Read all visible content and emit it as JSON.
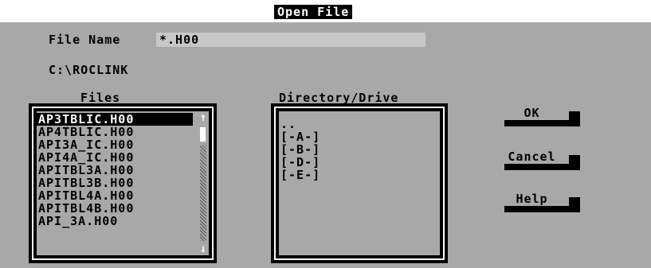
{
  "window": {
    "title": "Open File"
  },
  "file_name": {
    "label": "File Name",
    "value": "*.H00"
  },
  "current_path": "C:\\ROCLINK",
  "files": {
    "label": "Files",
    "items": [
      "AP3TBLIC.H00",
      "AP4TBLIC.H00",
      "API3A_IC.H00",
      "API4A_IC.H00",
      "APITBL3A.H00",
      "APITBL3B.H00",
      "APITBL4A.H00",
      "APITBL4B.H00",
      "API_3A.H00"
    ],
    "selected_index": 0
  },
  "directory": {
    "label": "Directory/Drive",
    "items": [
      "..",
      "[-A-]",
      "[-B-]",
      "[-D-]",
      "[-E-]"
    ]
  },
  "buttons": {
    "ok": "OK",
    "cancel": "Cancel",
    "help": "Help"
  },
  "icons": {
    "scroll_up": "↑",
    "scroll_down": "↓"
  },
  "colors": {
    "background": "#a8a8a8",
    "frame": "#000000",
    "highlight": "#ffffff"
  }
}
